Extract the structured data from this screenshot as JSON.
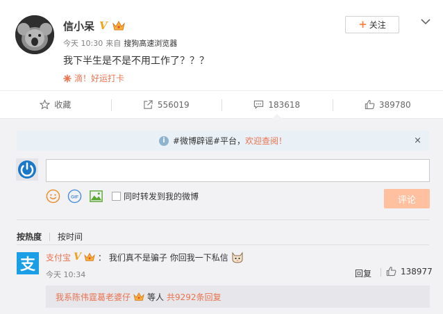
{
  "post": {
    "author_name": "信小呆",
    "verified_mark": "V",
    "time": "今天 10:30",
    "source_prefix": "来自",
    "source": "搜狗高速浏览器",
    "text": "我下半生是不是不用工作了？？？",
    "tag": "滴！好运打卡",
    "follow_label": "关注",
    "follow_plus": "+"
  },
  "actions": [
    {
      "label": "收藏",
      "icon": "star-icon"
    },
    {
      "label": "556019",
      "icon": "share-icon"
    },
    {
      "label": "183618",
      "icon": "comment-icon"
    },
    {
      "label": "389780",
      "icon": "thumbs-up-icon"
    }
  ],
  "comment_box": {
    "notice_text": "#微博辟谣#平台，",
    "notice_link": "欢迎查阅！",
    "info_glyph": "i",
    "close_glyph": "×",
    "repost_checkbox_label": "同时转发到我的微博",
    "submit_label": "评论"
  },
  "sort": {
    "hot_label": "按热度",
    "time_label": "按时间"
  },
  "comment": {
    "avatar_glyph": "支",
    "user": "支付宝",
    "verified_mark": "V",
    "separator": "：",
    "text": "我们真不是骗子 你回我一下私信",
    "time": "今天 10:34",
    "reply_label": "回复",
    "likes": "138977"
  },
  "sub_reply": {
    "user": "我系陈伟霆葛老婆仔",
    "middle": "等人",
    "link": "共9292条回复"
  },
  "colors": {
    "accent": "#eb7350",
    "verified_gold": "#f2a11a",
    "alipay_blue": "#1a9ee5",
    "submit_disabled": "#ffc09f",
    "comment_bg": "#f2f2f5"
  }
}
